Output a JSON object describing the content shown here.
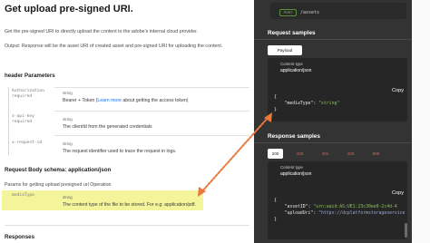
{
  "doc": {
    "title": "Get upload pre-signed URI.",
    "intro": "Get the pre-signed URI to directly upload the content to the adobe's internal cloud provider.",
    "output": "Output: Response will be the asset URI of created asset and pre-signed URI for uploading the content.",
    "header_params_title": "header Parameters",
    "header_params": [
      {
        "name": "Authorization",
        "required": "required",
        "type": "string",
        "desc": "Bearer + Token (",
        "link": "Learn more",
        "desc_after": " about getting the access token)"
      },
      {
        "name": "x-api-key",
        "required": "required",
        "type": "string",
        "desc": "The clientId from the generated credentials"
      },
      {
        "name": "x-request-id",
        "required": "",
        "type": "string",
        "desc": "The request identifier used to trace the request in logs."
      }
    ],
    "body_schema_label": "Request Body schema:",
    "body_schema_type": "application/json",
    "body_desc": "Params for getting upload presigned url Operation",
    "body_param": {
      "name": "mediaType",
      "type": "string",
      "desc": "The content type of the file to be stored. For e.g: application/pdf."
    },
    "responses_title": "Responses"
  },
  "panel": {
    "method": "POST",
    "path": "/assets",
    "request_samples_title": "Request samples",
    "request_tab": "Payload",
    "content_type_label": "Content type",
    "content_type_value": "application/json",
    "copy_label": "Copy",
    "request_code": {
      "open": "{",
      "key": "\"mediaType\"",
      "sep": ": ",
      "value": "\"string\"",
      "close": "}"
    },
    "response_samples_title": "Response samples",
    "response_tabs": [
      "200",
      "400",
      "401",
      "403",
      "500"
    ],
    "response_code": {
      "open": "{",
      "line1_key": "\"assetID\"",
      "line1_sep": ": ",
      "line1_val": "\"urn:aaid:AS:UE1:23c30ee0-2c4d-4",
      "line2_key": "\"uploadUri\"",
      "line2_sep": ": ",
      "line2_val": "\"https://dcplatformstorageservice",
      "close": "}"
    }
  },
  "colors": {
    "panel_bg": "#333333",
    "highlight": "#f4f49a",
    "arrow": "#e8793a",
    "link": "#1473e6",
    "error_tab_text": "#d96a62",
    "json_string": "#8fbf63"
  }
}
